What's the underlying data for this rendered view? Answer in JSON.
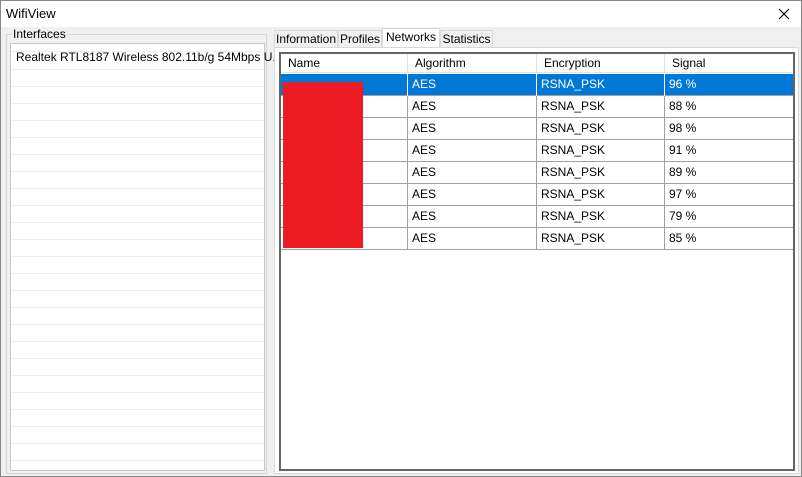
{
  "window": {
    "title": "WifiView"
  },
  "interfaces": {
    "title": "Interfaces",
    "items": [
      "Realtek RTL8187 Wireless 802.11b/g 54Mbps U..."
    ]
  },
  "tabs": [
    "Information",
    "Profiles",
    "Networks",
    "Statistics"
  ],
  "active_tab": "Networks",
  "networks": {
    "columns": [
      "Name",
      "Algorithm",
      "Encryption",
      "Signal"
    ],
    "rows": [
      {
        "name": "",
        "algorithm": "AES",
        "encryption": "RSNA_PSK",
        "signal": "96 %"
      },
      {
        "name": "",
        "algorithm": "AES",
        "encryption": "RSNA_PSK",
        "signal": "88 %"
      },
      {
        "name": "",
        "algorithm": "AES",
        "encryption": "RSNA_PSK",
        "signal": "98 %"
      },
      {
        "name": "",
        "algorithm": "AES",
        "encryption": "RSNA_PSK",
        "signal": "91 %"
      },
      {
        "name": "",
        "algorithm": "AES",
        "encryption": "RSNA_PSK",
        "signal": "89 %"
      },
      {
        "name": "",
        "algorithm": "AES",
        "encryption": "RSNA_PSK",
        "signal": "97 %"
      },
      {
        "name": "",
        "algorithm": "AES",
        "encryption": "RSNA_PSK",
        "signal": "79 %"
      },
      {
        "name": "",
        "algorithm": "AES",
        "encryption": "RSNA_PSK",
        "signal": "85 %"
      }
    ],
    "selected_row": 0
  },
  "colors": {
    "selection": "#0078d7",
    "redaction": "#ed1c24"
  }
}
